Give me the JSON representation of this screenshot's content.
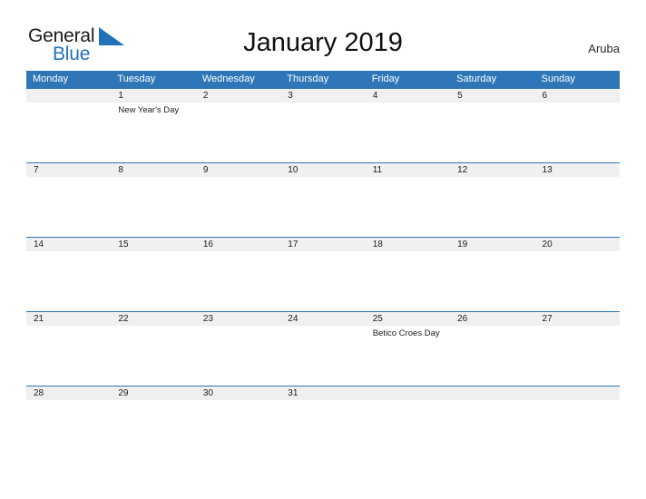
{
  "brand": {
    "name_part1": "General",
    "name_part2": "Blue",
    "flag_icon": "blue-flag-triangle-icon",
    "color_primary": "#2272b8",
    "color_text": "#1a1a1a"
  },
  "header": {
    "title": "January 2019",
    "region": "Aruba"
  },
  "calendar": {
    "accent_color": "#2e76b8",
    "date_strip_color": "#f0f0f0",
    "weekdays": [
      "Monday",
      "Tuesday",
      "Wednesday",
      "Thursday",
      "Friday",
      "Saturday",
      "Sunday"
    ],
    "weeks": [
      {
        "days": [
          {
            "date": "",
            "event": ""
          },
          {
            "date": "1",
            "event": "New Year's Day"
          },
          {
            "date": "2",
            "event": ""
          },
          {
            "date": "3",
            "event": ""
          },
          {
            "date": "4",
            "event": ""
          },
          {
            "date": "5",
            "event": ""
          },
          {
            "date": "6",
            "event": ""
          }
        ]
      },
      {
        "days": [
          {
            "date": "7",
            "event": ""
          },
          {
            "date": "8",
            "event": ""
          },
          {
            "date": "9",
            "event": ""
          },
          {
            "date": "10",
            "event": ""
          },
          {
            "date": "11",
            "event": ""
          },
          {
            "date": "12",
            "event": ""
          },
          {
            "date": "13",
            "event": ""
          }
        ]
      },
      {
        "days": [
          {
            "date": "14",
            "event": ""
          },
          {
            "date": "15",
            "event": ""
          },
          {
            "date": "16",
            "event": ""
          },
          {
            "date": "17",
            "event": ""
          },
          {
            "date": "18",
            "event": ""
          },
          {
            "date": "19",
            "event": ""
          },
          {
            "date": "20",
            "event": ""
          }
        ]
      },
      {
        "days": [
          {
            "date": "21",
            "event": ""
          },
          {
            "date": "22",
            "event": ""
          },
          {
            "date": "23",
            "event": ""
          },
          {
            "date": "24",
            "event": ""
          },
          {
            "date": "25",
            "event": "Betico Croes Day"
          },
          {
            "date": "26",
            "event": ""
          },
          {
            "date": "27",
            "event": ""
          }
        ]
      },
      {
        "days": [
          {
            "date": "28",
            "event": ""
          },
          {
            "date": "29",
            "event": ""
          },
          {
            "date": "30",
            "event": ""
          },
          {
            "date": "31",
            "event": ""
          },
          {
            "date": "",
            "event": ""
          },
          {
            "date": "",
            "event": ""
          },
          {
            "date": "",
            "event": ""
          }
        ]
      }
    ]
  }
}
